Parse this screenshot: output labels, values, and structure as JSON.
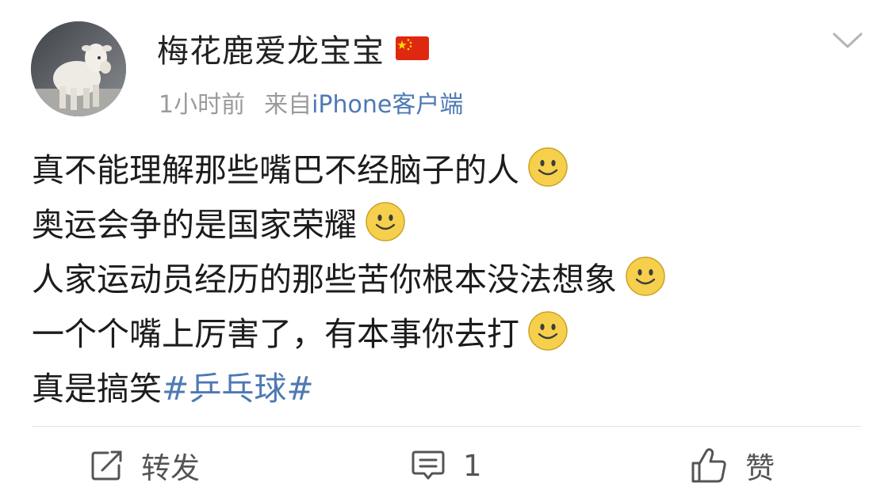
{
  "post": {
    "author": "梅花鹿爱龙宝宝",
    "flag_icon": "china-flag-icon",
    "time": "1小时前",
    "source_prefix": "来自",
    "source_app": "iPhone客户端",
    "lines": [
      {
        "text": "真不能理解那些嘴巴不经脑子的人",
        "emoji": "smiley-icon"
      },
      {
        "text": "奥运会争的是国家荣耀",
        "emoji": "smiley-icon"
      },
      {
        "text": "人家运动员经历的那些苦你根本没法想象",
        "emoji": "smiley-icon"
      },
      {
        "text": "一个个嘴上厉害了，有本事你去打",
        "emoji": "smiley-icon"
      }
    ],
    "last_line_text": "真是搞笑",
    "hashtag": "#乒乓球#"
  },
  "actions": {
    "repost_label": "转发",
    "comment_count": "1",
    "like_label": "赞"
  },
  "colors": {
    "link": "#4e79b4",
    "meta_gray": "#9b9b9b",
    "text": "#1c1c1c"
  }
}
